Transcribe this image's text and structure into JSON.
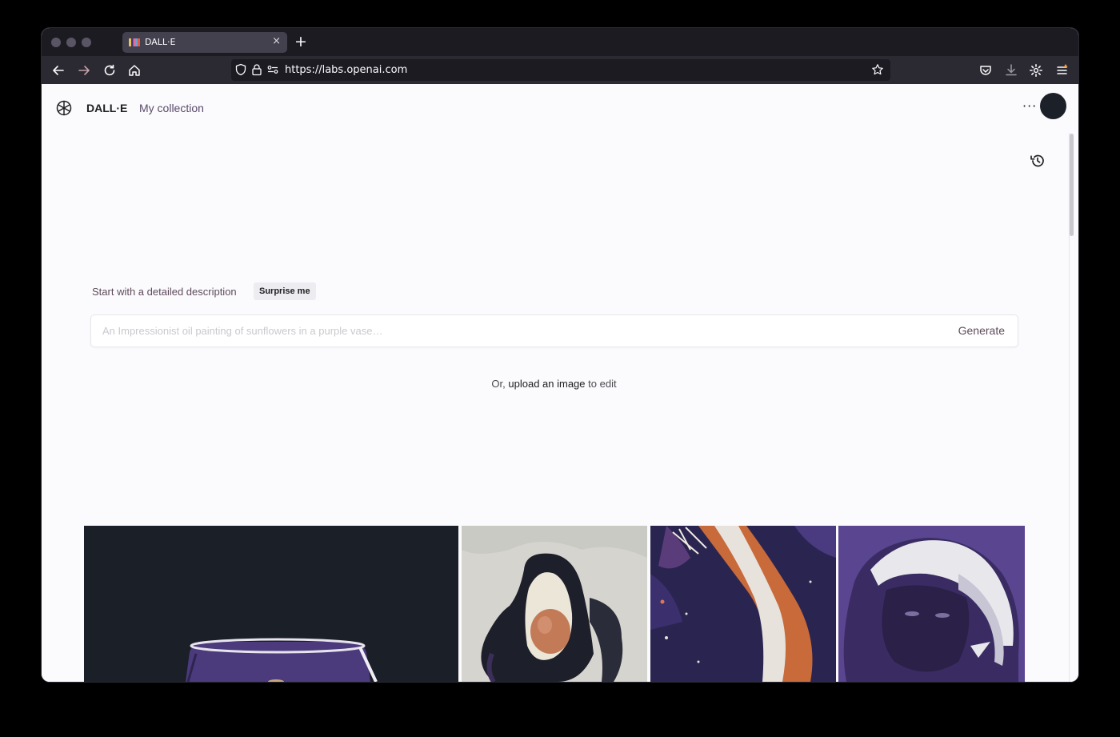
{
  "browser": {
    "tab_title": "DALL·E",
    "tab_close": "×",
    "new_tab": "+",
    "url": "https://labs.openai.com"
  },
  "header": {
    "brand": "DALL·E",
    "nav_link": "My collection",
    "more": "···"
  },
  "prompt": {
    "label": "Start with a detailed description",
    "surprise_label": "Surprise me",
    "placeholder": "An Impressionist oil painting of sunflowers in a purple vase…",
    "value": "",
    "generate_label": "Generate"
  },
  "upload": {
    "prefix": "Or,",
    "link": "upload an image",
    "suffix": "to edit"
  },
  "gallery": {
    "items": [
      {
        "subject": "purple-vase-image"
      },
      {
        "subject": "avocado-image"
      },
      {
        "subject": "space-explosion-image"
      },
      {
        "subject": "purple-yeti-image"
      }
    ]
  },
  "colors": {
    "chrome_dark": "#1c1b22",
    "chrome_nav": "#2b2a33",
    "page_bg": "#fbfbfd",
    "accent_text": "#5e4b5b",
    "avatar": "#1c2029"
  }
}
